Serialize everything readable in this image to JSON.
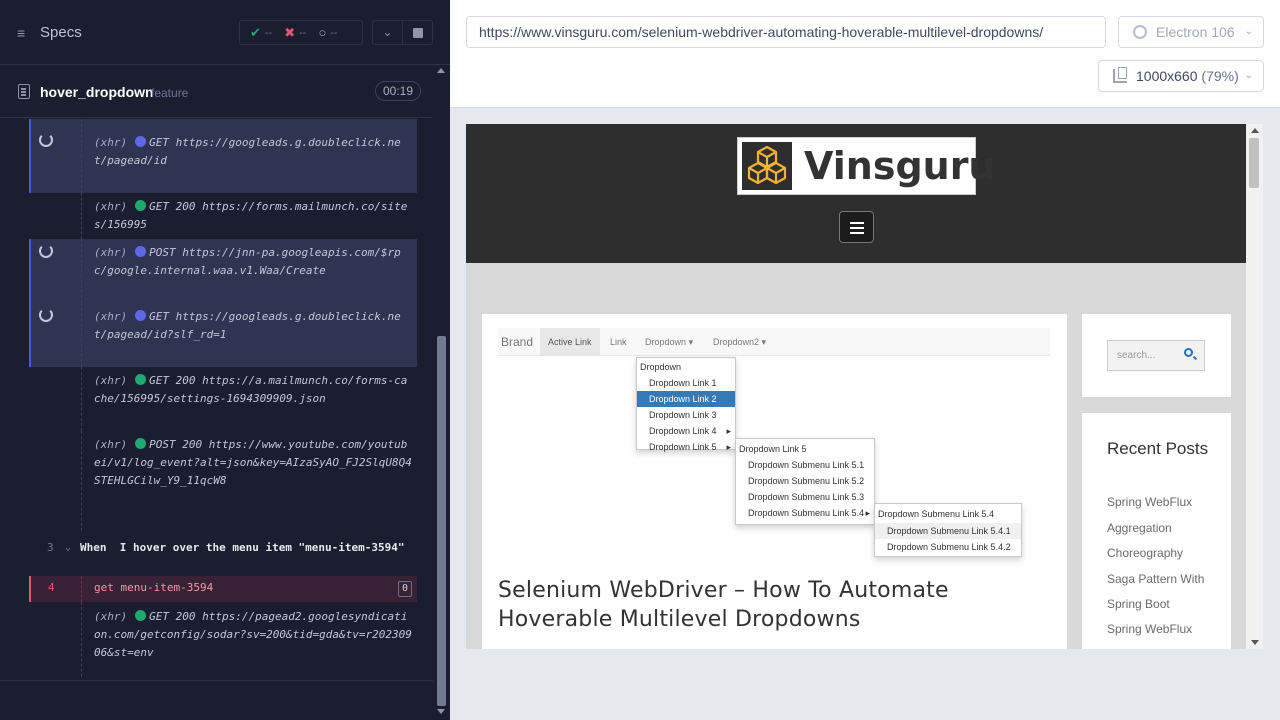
{
  "reporter": {
    "header": {
      "specs_label": "Specs",
      "stats": {
        "passed": "--",
        "failed": "--",
        "pending": "--"
      }
    },
    "spec": {
      "name": "hover_dropdown",
      "ext": "feature",
      "time": "00:19"
    },
    "commands": [
      {
        "state": "pending",
        "type": "(xhr)",
        "method": "GET",
        "status": "",
        "url": "https://googleads.g.doubleclick.net/pagead/id"
      },
      {
        "state": "done",
        "type": "(xhr)",
        "method": "GET",
        "status": "200",
        "url": "https://forms.mailmunch.co/sites/156995"
      },
      {
        "state": "pending",
        "type": "(xhr)",
        "method": "POST",
        "status": "",
        "url": "https://jnn-pa.googleapis.com/$rpc/google.internal.waa.v1.Waa/Create"
      },
      {
        "state": "pending",
        "type": "(xhr)",
        "method": "GET",
        "status": "",
        "url": "https://googleads.g.doubleclick.net/pagead/id?slf_rd=1"
      },
      {
        "state": "done",
        "type": "(xhr)",
        "method": "GET",
        "status": "200",
        "url": "https://a.mailmunch.co/forms-cache/156995/settings-1694309909.json"
      },
      {
        "state": "done",
        "type": "(xhr)",
        "method": "POST",
        "status": "200",
        "url": "https://www.youtube.com/youtubei/v1/log_event?alt=json&key=AIzaSyAO_FJ2SlqU8Q4STEHLGCilw_Y9_11qcW8"
      }
    ],
    "step_when": {
      "num": "3",
      "keyword": "When",
      "text": "I hover over the menu item \"menu-item-3594\""
    },
    "step_get": {
      "num": "4",
      "text": "get  menu-item-3594",
      "count": "0"
    },
    "last_command": {
      "type": "(xhr)",
      "method": "GET",
      "status": "200",
      "url": "https://pagead2.googlesyndication.com/getconfig/sodar?sv=200&tid=gda&tv=r20230906&st=env"
    }
  },
  "aut": {
    "url": "https://www.vinsguru.com/selenium-webdriver-automating-hoverable-multilevel-dropdowns/",
    "browser": "Electron 106",
    "viewport": "1000x660",
    "scale": "(79%)"
  },
  "site": {
    "logo_text": "Vinsguru",
    "demo": {
      "brand": "Brand",
      "nav": [
        "Active Link",
        "Link",
        "Dropdown ▾",
        "Dropdown2 ▾"
      ],
      "menu1": [
        "Dropdown",
        "Dropdown Link 1",
        "Dropdown Link 2",
        "Dropdown Link 3",
        "Dropdown Link 4",
        "Dropdown Link 5"
      ],
      "menu2": [
        "Dropdown Link 5",
        "Dropdown Submenu Link 5.1",
        "Dropdown Submenu Link 5.2",
        "Dropdown Submenu Link 5.3",
        "Dropdown Submenu Link 5.4"
      ],
      "menu3": [
        "Dropdown Submenu Link 5.4",
        "Dropdown Submenu Link 5.4.1",
        "Dropdown Submenu Link 5.4.2"
      ]
    },
    "post_title": "Selenium WebDriver – How To Automate Hoverable Multilevel Dropdowns",
    "search_placeholder": "search...",
    "recent_title": "Recent Posts",
    "recent_links": [
      "Spring WebFlux",
      "Aggregation",
      "Choreography",
      "Saga Pattern With",
      "Spring Boot",
      "Spring WebFlux"
    ]
  }
}
